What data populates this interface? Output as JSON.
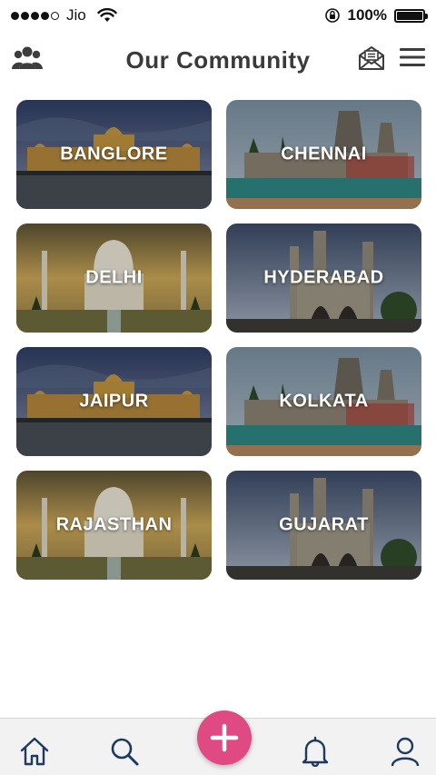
{
  "status_bar": {
    "carrier": "Jio",
    "battery_percent": "100%",
    "signal_bars_filled": 4,
    "signal_bars_total": 5
  },
  "header": {
    "title": "Our Community",
    "left_icon": "community-icon",
    "right_icons": [
      "mail-icon",
      "menu-icon"
    ]
  },
  "communities": [
    {
      "name": "BANGLORE",
      "scene": "palace"
    },
    {
      "name": "CHENNAI",
      "scene": "temple"
    },
    {
      "name": "DELHI",
      "scene": "tajmahal"
    },
    {
      "name": "HYDERABAD",
      "scene": "charminar"
    },
    {
      "name": "JAIPUR",
      "scene": "palace"
    },
    {
      "name": "KOLKATA",
      "scene": "temple"
    },
    {
      "name": "RAJASTHAN",
      "scene": "tajmahal"
    },
    {
      "name": "GUJARAT",
      "scene": "charminar"
    }
  ],
  "bottom_nav": {
    "items": [
      "home-icon",
      "search-icon",
      "add-icon",
      "bell-icon",
      "profile-icon"
    ]
  },
  "colors": {
    "accent": "#e04a83",
    "nav_icon": "#1f3a5f",
    "title": "#3a3a3a"
  }
}
